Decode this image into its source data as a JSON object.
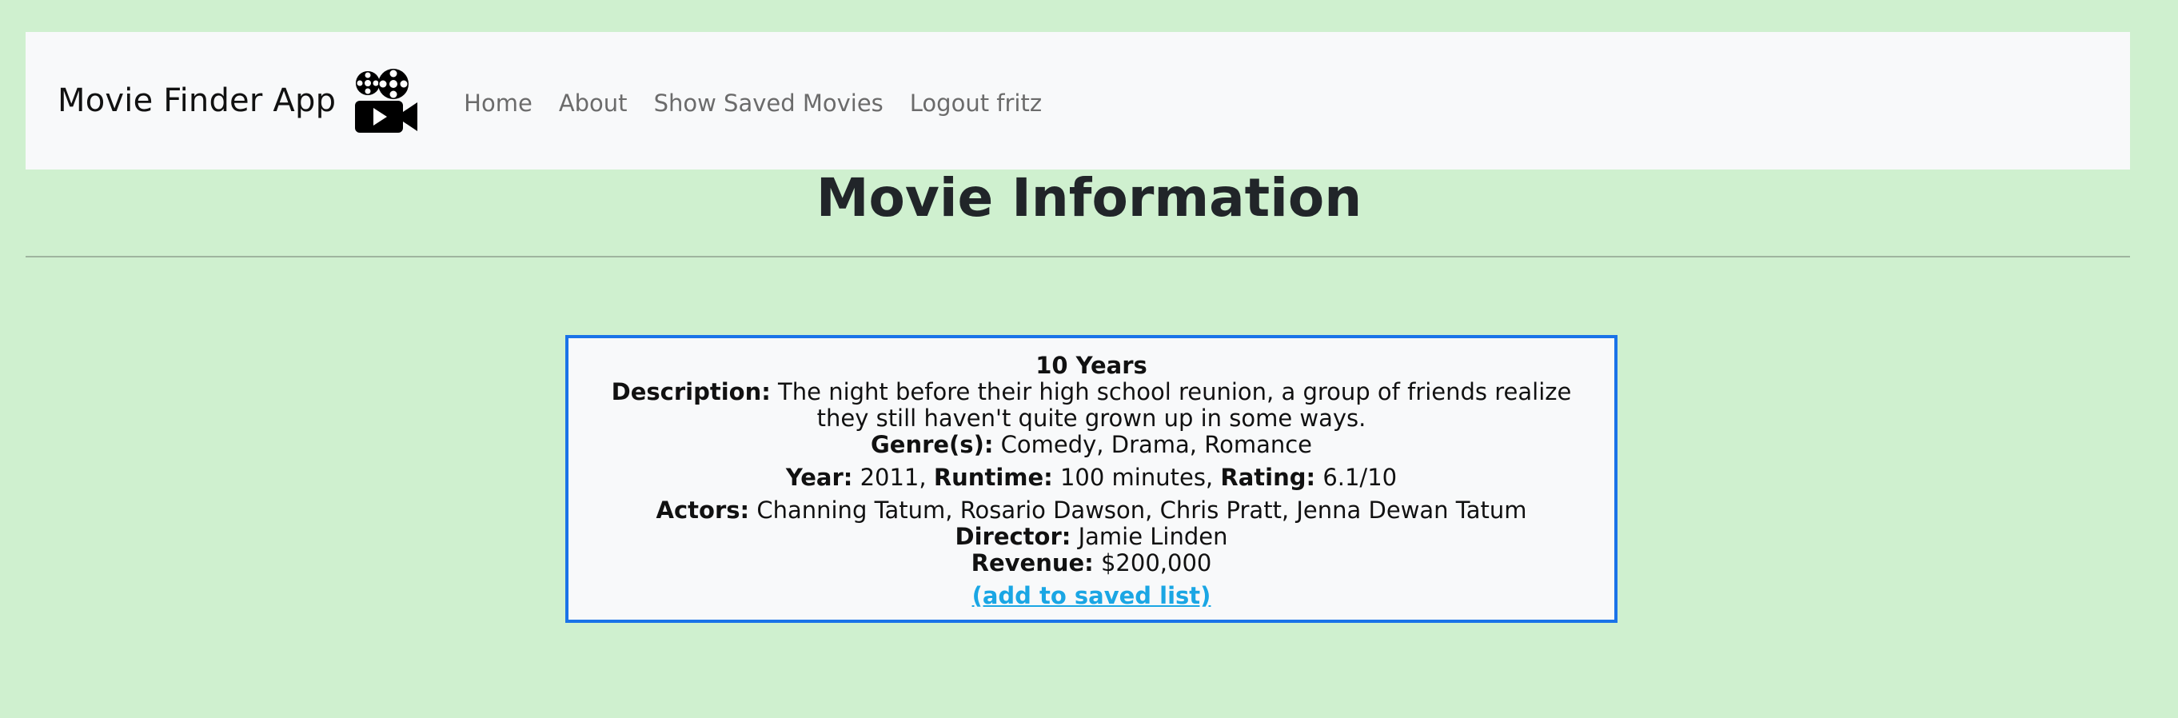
{
  "navbar": {
    "brand": "Movie Finder App",
    "brand_icon": "movie-camera-icon",
    "links": [
      "Home",
      "About",
      "Show Saved Movies",
      "Logout fritz"
    ]
  },
  "page": {
    "title": "Movie Information"
  },
  "movie": {
    "title": "10 Years",
    "description_label": "Description:",
    "description": "The night before their high school reunion, a group of friends realize they still haven't quite grown up in some ways.",
    "genres_label": "Genre(s):",
    "genres": "Comedy, Drama, Romance",
    "year_label": "Year:",
    "year": "2011,",
    "runtime_label": "Runtime:",
    "runtime": "100 minutes,",
    "rating_label": "Rating:",
    "rating": "6.1/10",
    "actors_label": "Actors:",
    "actors": "Channing Tatum, Rosario Dawson, Chris Pratt, Jenna Dewan Tatum",
    "director_label": "Director:",
    "director": "Jamie Linden",
    "revenue_label": "Revenue:",
    "revenue": "$200,000",
    "save_link": "(add to saved list)"
  },
  "colors": {
    "background": "#cff0cf",
    "navbar": "#f8f9fa",
    "card_border": "#1a73e8",
    "link": "#1aa6e4"
  }
}
